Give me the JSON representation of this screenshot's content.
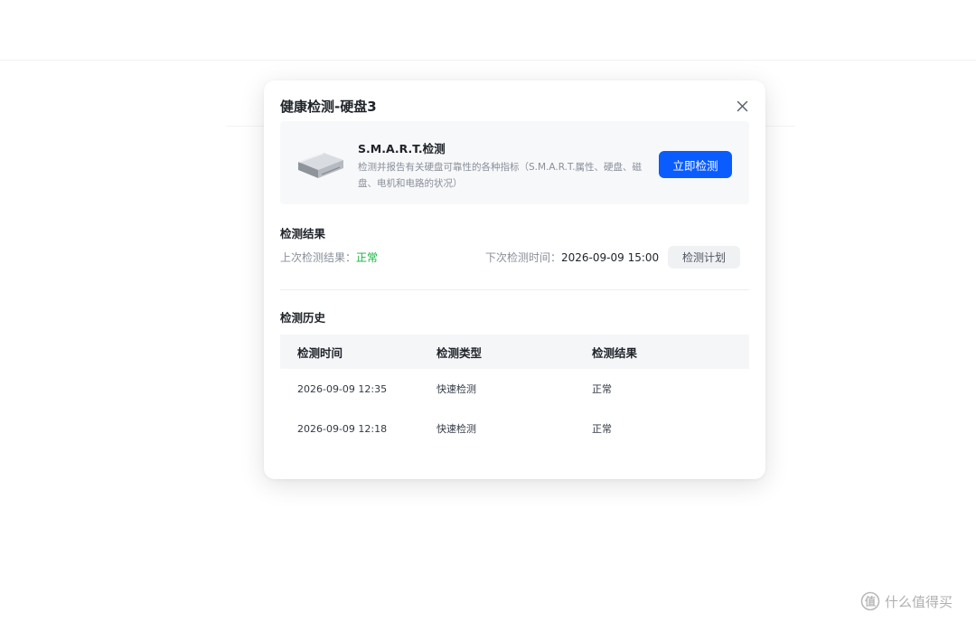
{
  "modal": {
    "title": "健康检测-硬盘3",
    "close_icon": "close-icon"
  },
  "smart": {
    "icon": "hard-disk-icon",
    "title": "S.M.A.R.T.检测",
    "description": "检测并报告有关硬盘可靠性的各种指标（S.M.A.R.T.属性、硬盘、磁盘、电机和电路的状况）",
    "check_now_label": "立即检测"
  },
  "result": {
    "section_title": "检测结果",
    "last_result_label": "上次检测结果：",
    "last_result_value": "正常",
    "next_time_label": "下次检测时间：",
    "next_time_value": "2026-09-09 15:00",
    "plan_button_label": "检测计划"
  },
  "history": {
    "section_title": "检测历史",
    "columns": [
      "检测时间",
      "检测类型",
      "检测结果"
    ],
    "rows": [
      [
        "2026-09-09 12:35",
        "快速检测",
        "正常"
      ],
      [
        "2026-09-09 12:18",
        "快速检测",
        "正常"
      ]
    ]
  },
  "watermark": {
    "text": "什么值得买",
    "icon": "smzdm-logo-icon"
  },
  "colors": {
    "primary": "#0a5cff",
    "status_normal": "#14b33f"
  }
}
